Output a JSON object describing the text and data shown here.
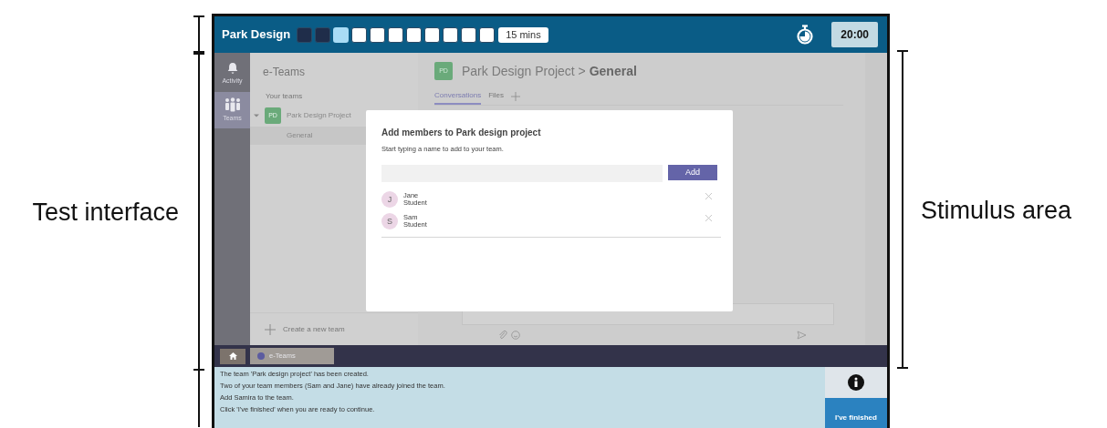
{
  "annotations": {
    "left_label": "Test interface",
    "right_label": "Stimulus area"
  },
  "top_bar": {
    "title": "Park Design",
    "progress": [
      {
        "done": true,
        "selected": false
      },
      {
        "done": true,
        "selected": false
      },
      {
        "done": false,
        "selected": true
      },
      {
        "done": false,
        "selected": false
      },
      {
        "done": false,
        "selected": false
      },
      {
        "done": false,
        "selected": false
      },
      {
        "done": false,
        "selected": false
      },
      {
        "done": false,
        "selected": false
      },
      {
        "done": false,
        "selected": false
      },
      {
        "done": false,
        "selected": false
      },
      {
        "done": false,
        "selected": false
      }
    ],
    "time_limit": "15 mins",
    "timer": "20:00"
  },
  "rail": [
    {
      "kind": "bell",
      "label": "Activity",
      "selected": false
    },
    {
      "kind": "people",
      "label": "Teams",
      "selected": true
    }
  ],
  "teams_panel": {
    "title": "e-Teams",
    "section": "Your teams",
    "teams": [
      {
        "avatar": "PD",
        "name": "Park Design Project",
        "expanded": true,
        "children": [
          {
            "name": "General",
            "selected": true
          }
        ]
      }
    ],
    "create": "Create a new team"
  },
  "channel": {
    "avatar": "PD",
    "title": "Park Design Project > **General**",
    "tabs": [
      {
        "label": "Conversations",
        "selected": true
      },
      {
        "label": "Files",
        "selected": false
      }
    ]
  },
  "dialog": {
    "title": "Add members to Park design project",
    "hint": "Start typing a name to add to your team.",
    "button": "Add",
    "members": [
      {
        "initial": "J",
        "name": "Jane",
        "role": "Student"
      },
      {
        "initial": "S",
        "name": "Sam",
        "role": "Student"
      }
    ]
  },
  "taskbar": {
    "apps": [
      {
        "label": "e-Teams"
      }
    ]
  },
  "instructions": [
    "The team 'Park design project' has been created.",
    "Two of your team members (Sam and Jane) have already joined the team.",
    "Add Samira to the team.",
    "Click 'I've finished' when you are ready to continue."
  ],
  "finish_button": "I've finished"
}
